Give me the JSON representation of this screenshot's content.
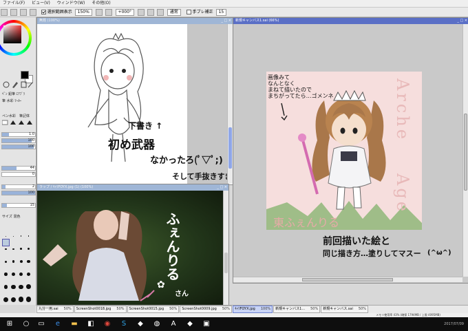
{
  "menu": {
    "items": [
      "ファイル(F)",
      "ビュー(V)",
      "ウィンドウ(W)",
      "その他(O)"
    ]
  },
  "toolbar": {
    "checkbox_label": "選択範囲表示",
    "zoom": "150%",
    "angle": "+000°",
    "blend_label": "通常",
    "stabilizer_label": "手ブレ補正",
    "stabilizer_value": "15"
  },
  "left_panel": {
    "tool_label_1": "ペン水彩",
    "tool_label_2": "筆記体",
    "size_value": "1.0",
    "density_value": "100",
    "value_44": "44",
    "value_0": "0",
    "value_2": "2",
    "value_100": "100",
    "value_15": "15",
    "value_100b": "100",
    "checkbox_size": "サイズ",
    "checkbox_mix": "混色",
    "brush_sizes": [
      "1",
      "1.5",
      "2",
      "2.3",
      "2.6",
      "3",
      "3.5",
      "4",
      "5",
      "6",
      "7",
      "8",
      "9",
      "10",
      "12",
      "14",
      "16",
      "20",
      "25",
      "30",
      "35",
      "40",
      "50",
      "60",
      "70",
      "80",
      "100"
    ],
    "selected_brush_index": 4
  },
  "windows": {
    "sketch": {
      "title": "無題 (100%)"
    },
    "photo": {
      "title": "ラップ / ｷｬﾗFOYX.jpg (1) (100%)"
    },
    "drawing": {
      "title": "新規キャンバス1.sai (66%)"
    }
  },
  "drawing": {
    "text_arche": "Arche",
    "text_age": "Age",
    "note_top": "画像みて\nなんとなく\nまねて描いたので\nまちがってたら…ゴメンネ",
    "name_text": "東ふぇんりる"
  },
  "handwriting": {
    "line1": "下書き ↑",
    "line2": "初め武器",
    "line3": "なかったろ(ﾟ▽ﾟ;)",
    "line4": "そして手抜きすぎ///",
    "right_line1": "前回描いた絵と",
    "right_line2": "同じ描き方…塗りしてマスー",
    "right_face": "(^ω^)",
    "photo_text1": "ふぇんりる",
    "photo_text2": "さん"
  },
  "tabs": [
    {
      "label": "九分一用.sai",
      "zoom": "50%",
      "active": false
    },
    {
      "label": "ScreenShot0018.jpg",
      "zoom": "50%",
      "active": false
    },
    {
      "label": "ScreenShot0015.jpg",
      "zoom": "50%",
      "active": false
    },
    {
      "label": "ScreenShot0009.jpg",
      "zoom": "50%",
      "active": false
    },
    {
      "label": "ｷｬﾗFOYX.jpg",
      "zoom": "100%",
      "active": true
    },
    {
      "label": "新規キャンバス1...",
      "zoom": "50%",
      "active": false
    },
    {
      "label": "新規キャンバス.sai",
      "zoom": "50%",
      "active": false
    }
  ],
  "status": "メモリ使用率 43% (確保 1794MB / 上限 4095MB)",
  "taskbar": {
    "time": "2017/07/09"
  },
  "colors": {
    "active_title": "#5a6fc6",
    "inactive_title": "#9fb6d6",
    "drawing_bg": "#f6dedd",
    "scroll_thumb": "#8fa6e8"
  }
}
